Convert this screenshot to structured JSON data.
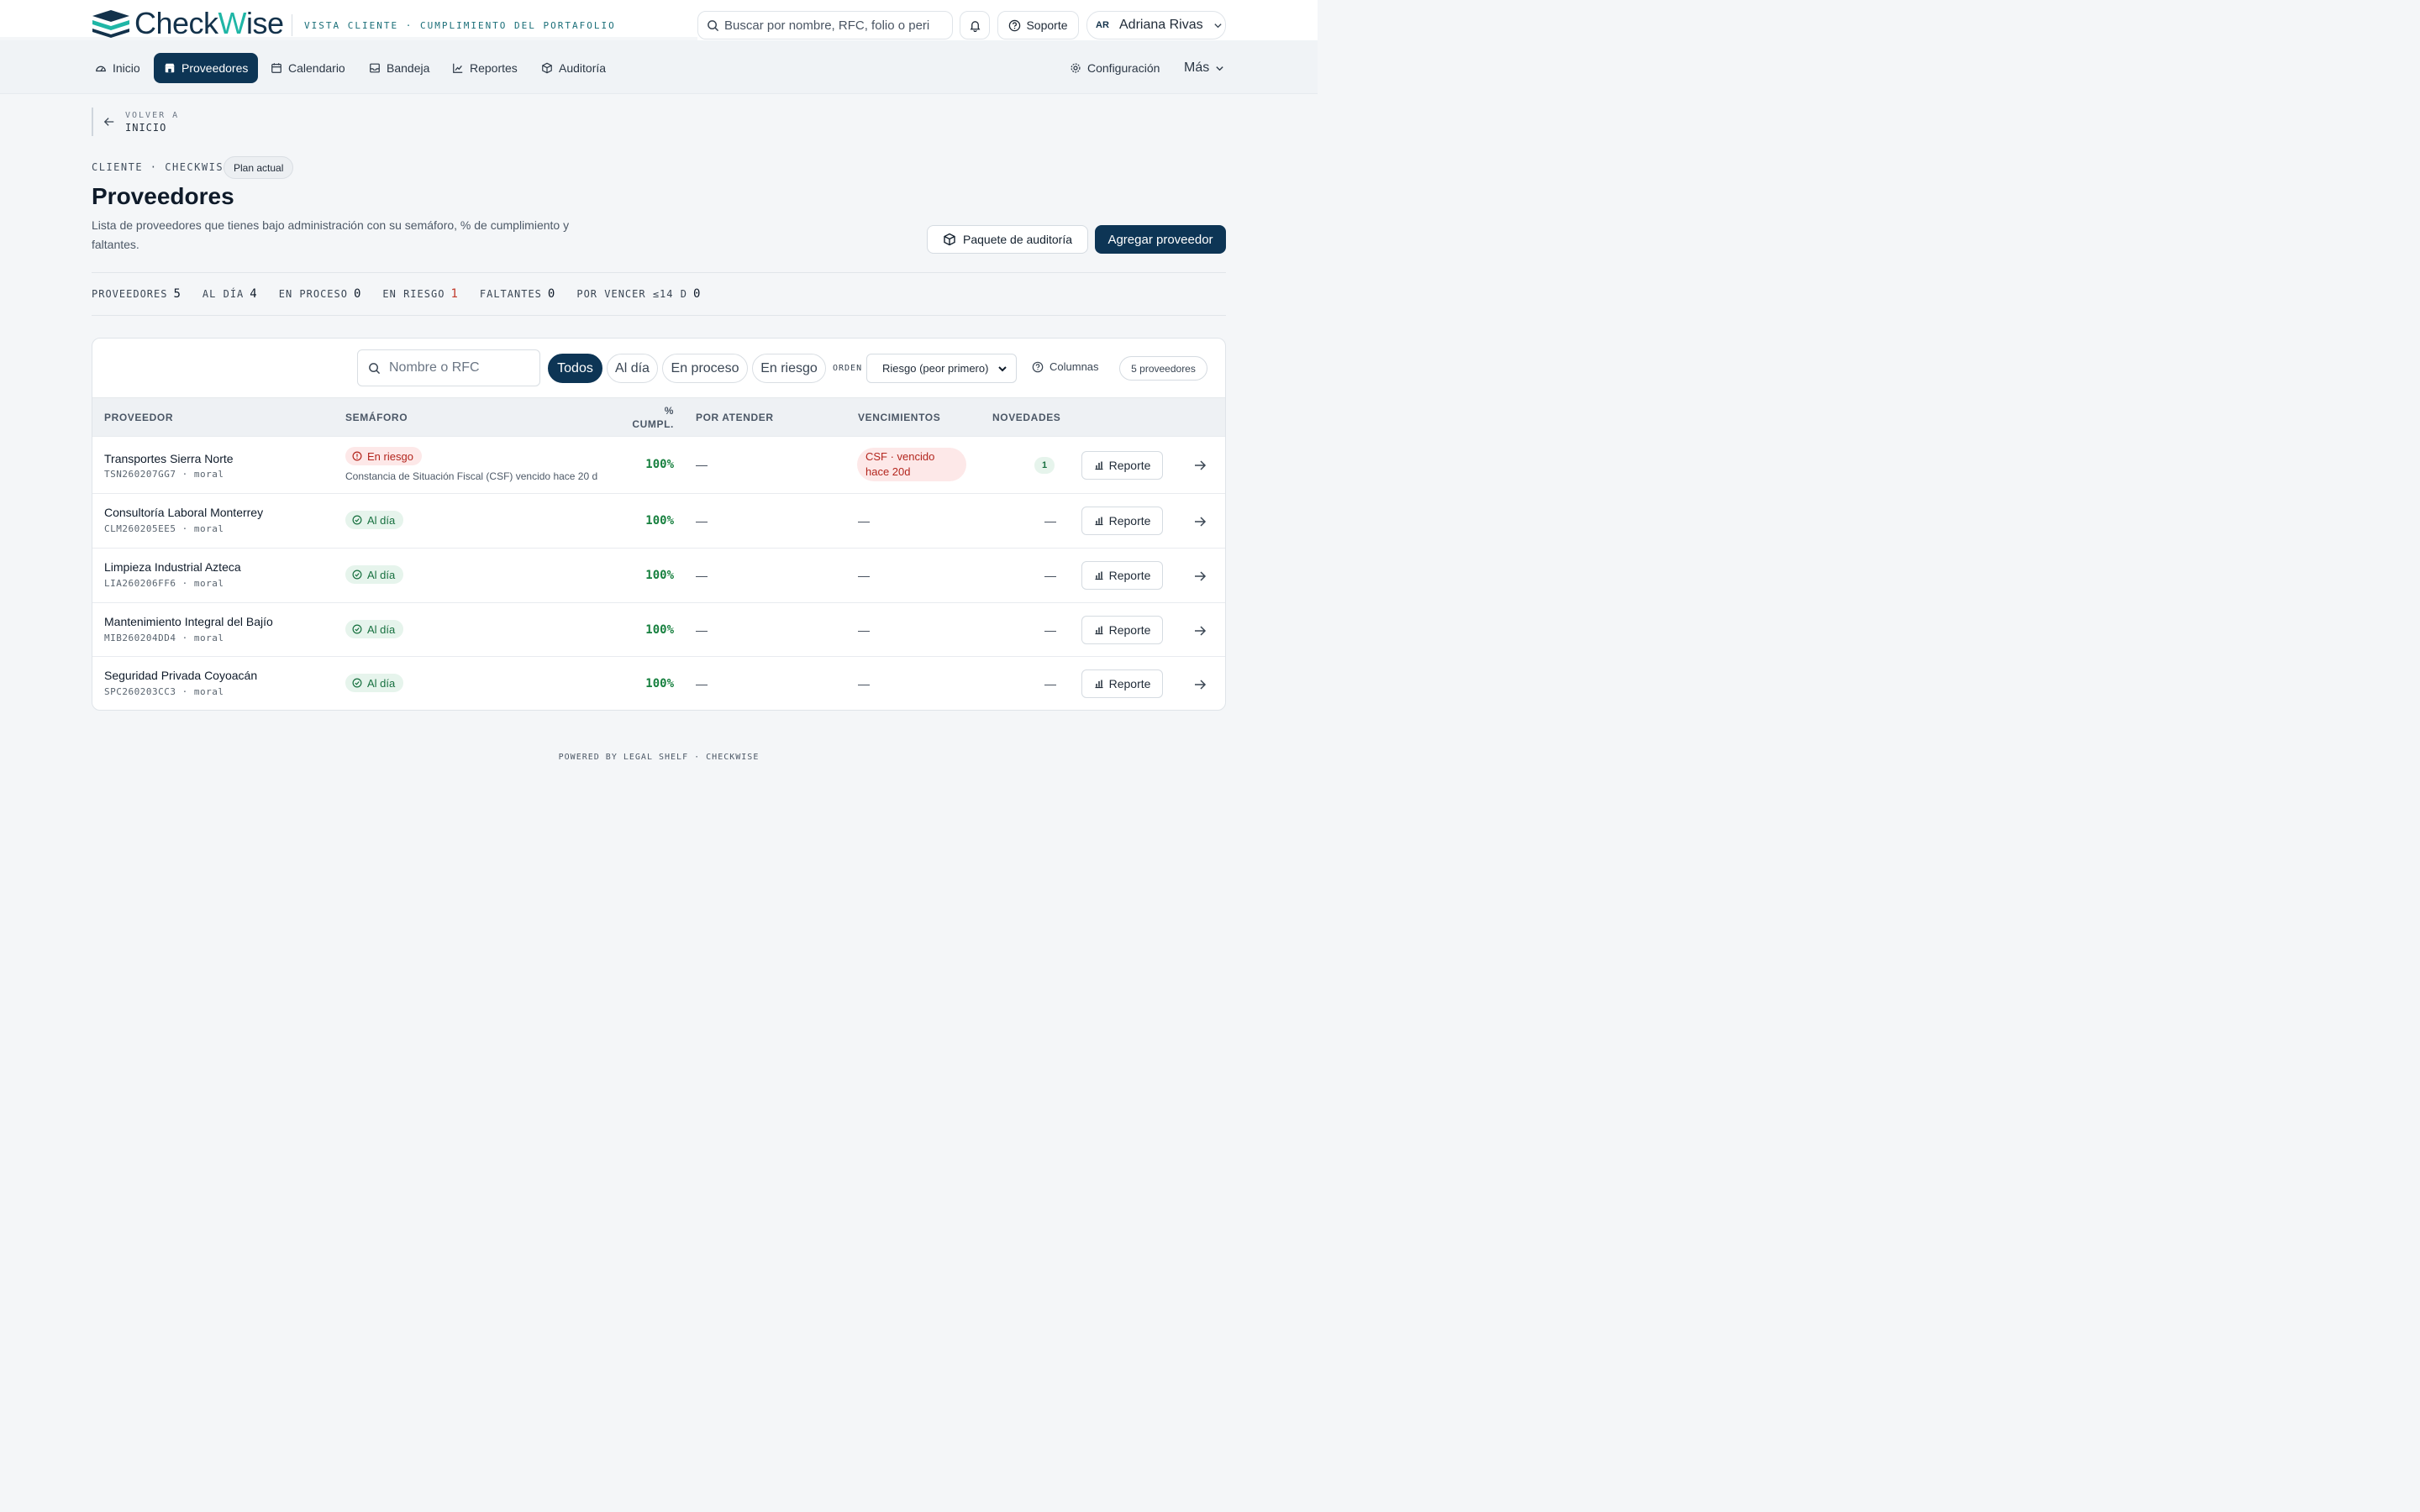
{
  "app": {
    "brand_prefix": "Check",
    "brand_w": "W",
    "brand_suffix": "ise",
    "tagline": "VISTA CLIENTE · CUMPLIMIENTO DEL PORTAFOLIO"
  },
  "header": {
    "search_placeholder": "Buscar por nombre, RFC, folio o peri",
    "support_label": "Soporte",
    "user_initials": "AR",
    "user_name": "Adriana Rivas"
  },
  "nav": {
    "items": [
      {
        "label": "Inicio",
        "icon": "dashboard-icon"
      },
      {
        "label": "Proveedores",
        "icon": "store-icon",
        "active": true
      },
      {
        "label": "Calendario",
        "icon": "calendar-icon"
      },
      {
        "label": "Bandeja",
        "icon": "inbox-icon"
      },
      {
        "label": "Reportes",
        "icon": "chart-line-icon"
      },
      {
        "label": "Auditoría",
        "icon": "box-icon"
      }
    ],
    "settings_label": "Configuración",
    "more_label": "Más"
  },
  "back": {
    "small": "VOLVER A",
    "big": "INICIO"
  },
  "page": {
    "crumb": "CLIENTE · CHECKWISE",
    "plan_badge": "Plan actual",
    "title": "Proveedores",
    "description": "Lista de proveedores que tienes bajo administración con su semáforo, % de cumplimiento y faltantes.",
    "audit_button": "Paquete de auditoría",
    "add_button": "Agregar proveedor"
  },
  "stats": [
    {
      "label": "PROVEEDORES",
      "value": "5"
    },
    {
      "label": "AL DÍA",
      "value": "4"
    },
    {
      "label": "EN PROCESO",
      "value": "0"
    },
    {
      "label": "EN RIESGO",
      "value": "1",
      "color": "#c0392b"
    },
    {
      "label": "FALTANTES",
      "value": "0"
    },
    {
      "label": "POR VENCER ≤14 D",
      "value": "0"
    }
  ],
  "filters": {
    "search_placeholder": "Nombre o RFC",
    "pills": [
      "Todos",
      "Al día",
      "En proceso",
      "En riesgo"
    ],
    "order_label": "ORDEN",
    "order_value": "Riesgo (peor primero)",
    "columns_label": "Columnas",
    "count_label": "5 proveedores"
  },
  "table": {
    "headers": {
      "provider": "PROVEEDOR",
      "semaforo": "SEMÁFORO",
      "pct_line1": "%",
      "pct_line2": "CUMPL.",
      "pending": "POR ATENDER",
      "expiry": "VENCIMIENTOS",
      "news": "NOVEDADES"
    },
    "report_label": "Reporte",
    "dash": "—",
    "rows": [
      {
        "name": "Transportes Sierra Norte",
        "rfc": "TSN260207GG7 · moral",
        "status": "En riesgo",
        "status_type": "risk",
        "note": "Constancia de Situación Fiscal (CSF) vencido hace 20 d",
        "pct": "100%",
        "pending": "—",
        "expiry": "CSF · vencido hace 20d",
        "news": "1"
      },
      {
        "name": "Consultoría Laboral Monterrey",
        "rfc": "CLM260205EE5 · moral",
        "status": "Al día",
        "status_type": "ok",
        "pct": "100%",
        "pending": "—",
        "expiry": "—",
        "news": "—"
      },
      {
        "name": "Limpieza Industrial Azteca",
        "rfc": "LIA260206FF6 · moral",
        "status": "Al día",
        "status_type": "ok",
        "pct": "100%",
        "pending": "—",
        "expiry": "—",
        "news": "—"
      },
      {
        "name": "Mantenimiento Integral del Bajío",
        "rfc": "MIB260204DD4 · moral",
        "status": "Al día",
        "status_type": "ok",
        "pct": "100%",
        "pending": "—",
        "expiry": "—",
        "news": "—"
      },
      {
        "name": "Seguridad Privada Coyoacán",
        "rfc": "SPC260203CC3 · moral",
        "status": "Al día",
        "status_type": "ok",
        "pct": "100%",
        "pending": "—",
        "expiry": "—",
        "news": "—"
      }
    ]
  },
  "footer": "POWERED BY LEGAL SHELF · CHECKWISE",
  "colors": {
    "brand_navy": "#0d3555",
    "brand_teal": "#1fb6a6",
    "ok_green": "#17703f",
    "risk_red": "#b3261e"
  }
}
